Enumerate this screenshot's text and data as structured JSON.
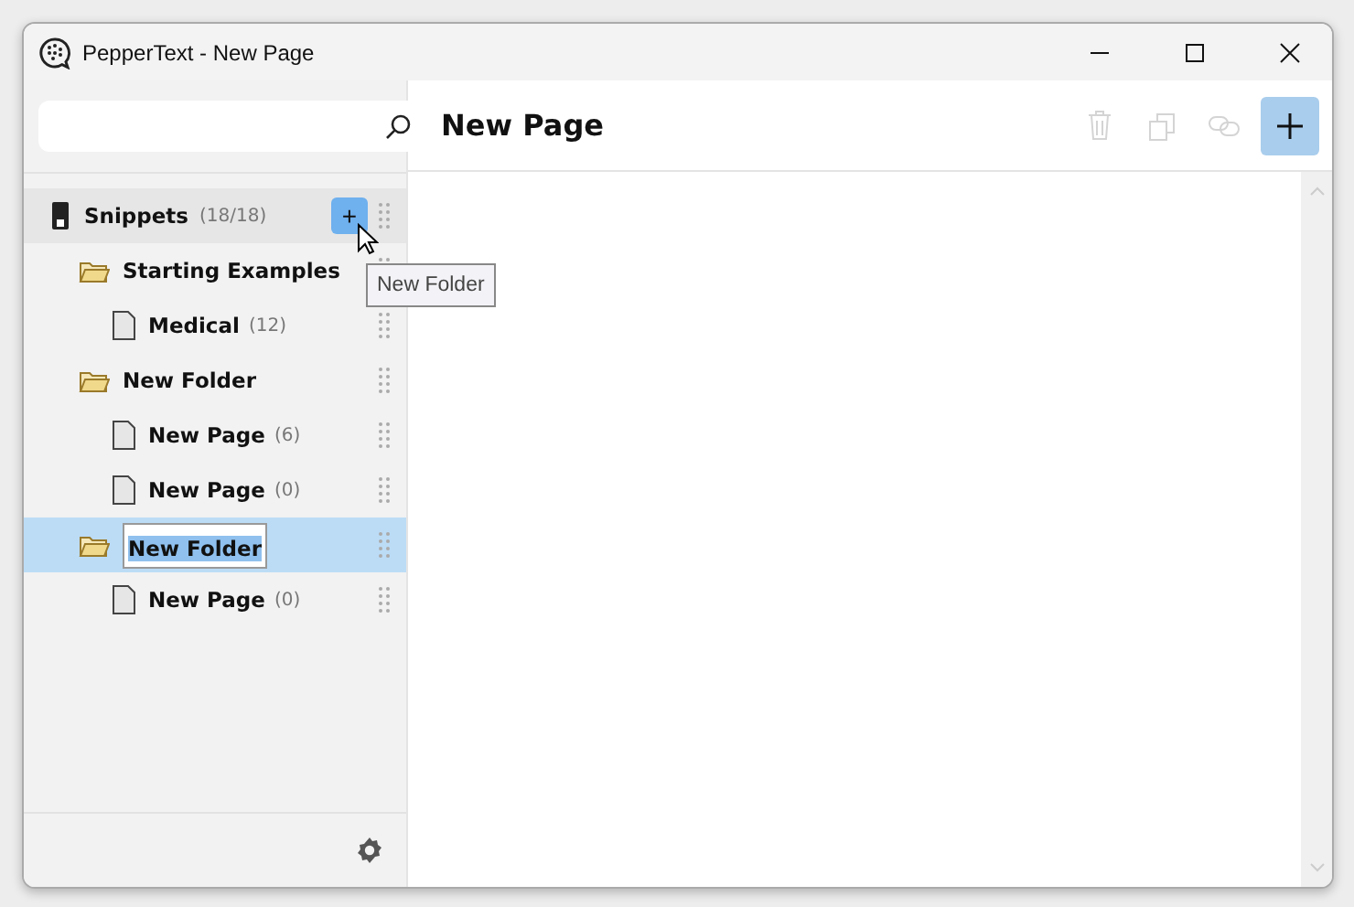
{
  "window": {
    "title": "PepperText - New Page"
  },
  "sidebar": {
    "tree": {
      "label": "Snippets",
      "count": "(18/18)",
      "add_button": "+",
      "add_tooltip": "New Folder",
      "children": [
        {
          "kind": "folder",
          "label": "Starting Examples",
          "selected": false,
          "editing": false,
          "children": [
            {
              "kind": "page",
              "label": "Medical",
              "count": "(12)",
              "selected": false
            }
          ]
        },
        {
          "kind": "folder",
          "label": "New Folder",
          "selected": false,
          "editing": false,
          "children": [
            {
              "kind": "page",
              "label": "New Page",
              "count": "(6)",
              "selected": false
            },
            {
              "kind": "page",
              "label": "New Page",
              "count": "(0)",
              "selected": false
            }
          ]
        },
        {
          "kind": "folder",
          "label": "New Folder",
          "selected": true,
          "editing": true,
          "children": [
            {
              "kind": "page",
              "label": "New Page",
              "count": "(0)",
              "selected": false
            }
          ]
        }
      ]
    }
  },
  "editor": {
    "title": "New Page",
    "toolbar": [
      {
        "kind": "trash",
        "disabled": true
      },
      {
        "kind": "copy",
        "disabled": true
      },
      {
        "kind": "link",
        "disabled": true
      },
      {
        "kind": "add",
        "disabled": false
      }
    ]
  }
}
